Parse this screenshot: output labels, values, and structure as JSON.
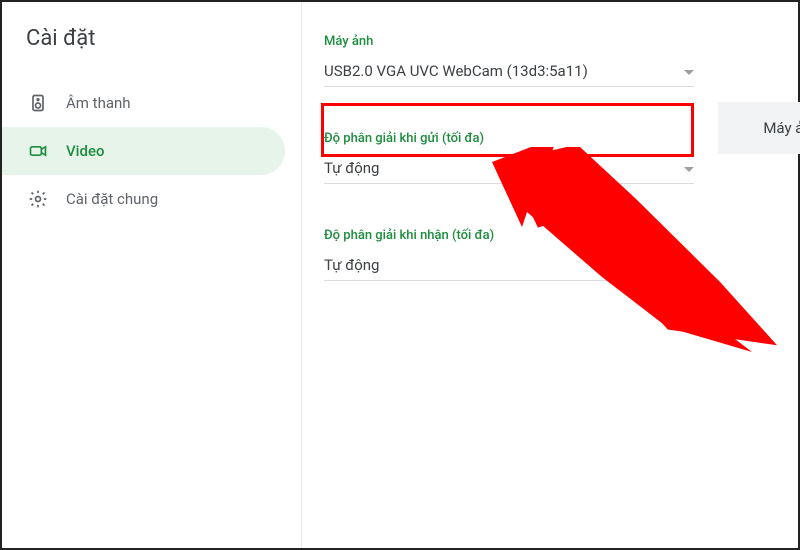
{
  "sidebar": {
    "title": "Cài đặt",
    "items": [
      {
        "label": "Âm thanh",
        "active": false
      },
      {
        "label": "Video",
        "active": true
      },
      {
        "label": "Cài đặt chung",
        "active": false
      }
    ]
  },
  "main": {
    "camera": {
      "label": "Máy ảnh",
      "value": "USB2.0 VGA UVC WebCam (13d3:5a11)"
    },
    "send_resolution": {
      "label": "Độ phân giải khi gửi (tối đa)",
      "value": "Tự động"
    },
    "receive_resolution": {
      "label": "Độ phân giải khi nhận (tối đa)",
      "value": "Tự động"
    },
    "preview_label": "Máy ảnh đ"
  }
}
